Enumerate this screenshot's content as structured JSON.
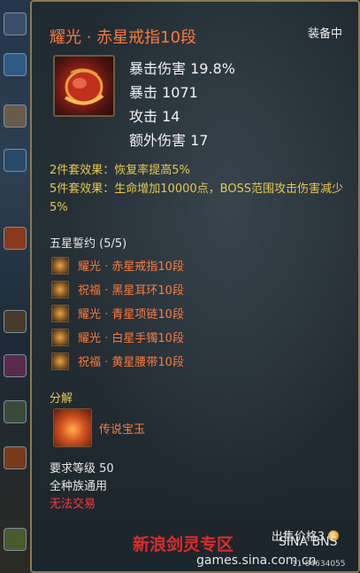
{
  "item": {
    "name": "耀光 · 赤星戒指10段",
    "status": "装备中",
    "icon": "red-star-ring-icon",
    "stats": [
      "暴击伤害 19.8%",
      "暴击 1071",
      "攻击 14",
      "额外伤害 17"
    ]
  },
  "set_effects": [
    "2件套效果：恢复率提高5%",
    "5件套效果：生命增加10000点，BOSS范围攻击伤害减少5%"
  ],
  "oath": {
    "title": "五星誓约 (5/5)",
    "items": [
      {
        "label": "耀光 · 赤星戒指10段",
        "icon": "ring-icon"
      },
      {
        "label": "祝福 · 黑星耳环10段",
        "icon": "earring-icon"
      },
      {
        "label": "耀光 · 青星项链10段",
        "icon": "necklace-icon"
      },
      {
        "label": "耀光 · 白星手镯10段",
        "icon": "bracelet-icon"
      },
      {
        "label": "祝福 · 黄星腰带10段",
        "icon": "belt-icon"
      }
    ]
  },
  "decompose": {
    "title": "分解",
    "result": "传说宝玉",
    "icon": "legendary-jade-icon"
  },
  "requirements": {
    "level": "要求等级 50",
    "race": "全种族通用",
    "trade": "无法交易"
  },
  "price": {
    "label": "出售价格3",
    "icon": "gold-coin-icon"
  },
  "watermark": {
    "site": "新浪剑灵专区",
    "brand": "SINA BNS",
    "url": "games.sina.com.cn",
    "id": "11-84634055"
  },
  "colors": {
    "item_name": "#ff7a3a",
    "set_effect": "#e8c84a",
    "untradeable": "#ff3a3a",
    "border": "#8a7b52"
  }
}
